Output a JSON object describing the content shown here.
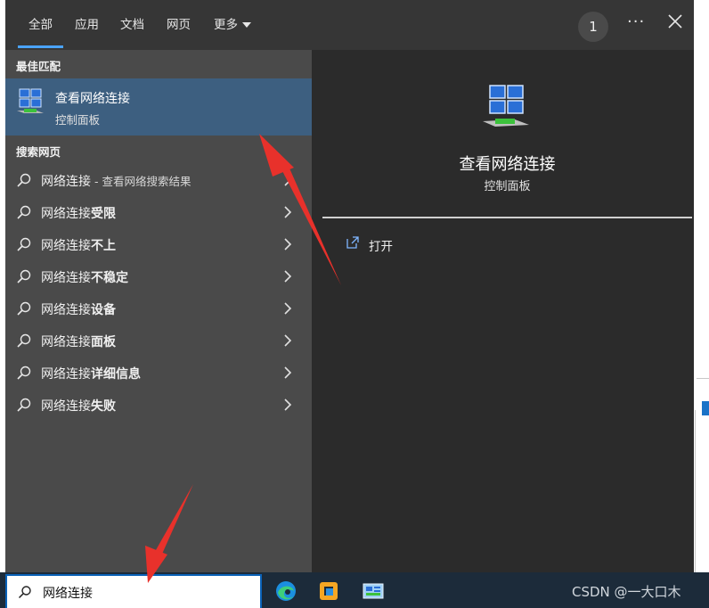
{
  "tabs": [
    {
      "label": "全部",
      "active": true
    },
    {
      "label": "应用"
    },
    {
      "label": "文档"
    },
    {
      "label": "网页"
    },
    {
      "label": "更多"
    }
  ],
  "topbar": {
    "badge": "1",
    "more_glyph": "···"
  },
  "best_match": {
    "section": "最佳匹配",
    "title": "查看网络连接",
    "subtitle": "控制面板",
    "icon": "network-connections-icon"
  },
  "web_search": {
    "section": "搜索网页",
    "items": [
      {
        "prefix": "网络连接",
        "bold": "",
        "suffix": " - 查看网络搜索结果"
      },
      {
        "prefix": "网络连接",
        "bold": "受限",
        "suffix": ""
      },
      {
        "prefix": "网络连接",
        "bold": "不上",
        "suffix": ""
      },
      {
        "prefix": "网络连接",
        "bold": "不稳定",
        "suffix": ""
      },
      {
        "prefix": "网络连接",
        "bold": "设备",
        "suffix": ""
      },
      {
        "prefix": "网络连接",
        "bold": "面板",
        "suffix": ""
      },
      {
        "prefix": "网络连接",
        "bold": "详细信息",
        "suffix": ""
      },
      {
        "prefix": "网络连接",
        "bold": "失败",
        "suffix": ""
      }
    ]
  },
  "preview": {
    "title": "查看网络连接",
    "subtitle": "控制面板",
    "actions": [
      {
        "label": "打开",
        "icon": "open-external-icon"
      }
    ]
  },
  "taskbar": {
    "search_value": "网络连接",
    "apps": [
      "edge-icon",
      "office-icon",
      "control-panel-icon"
    ],
    "watermark": "CSDN @一大口木"
  },
  "colors": {
    "accent": "#4aa3ff",
    "selected_row": "#3d5f80",
    "arrow": "#e8312b"
  }
}
